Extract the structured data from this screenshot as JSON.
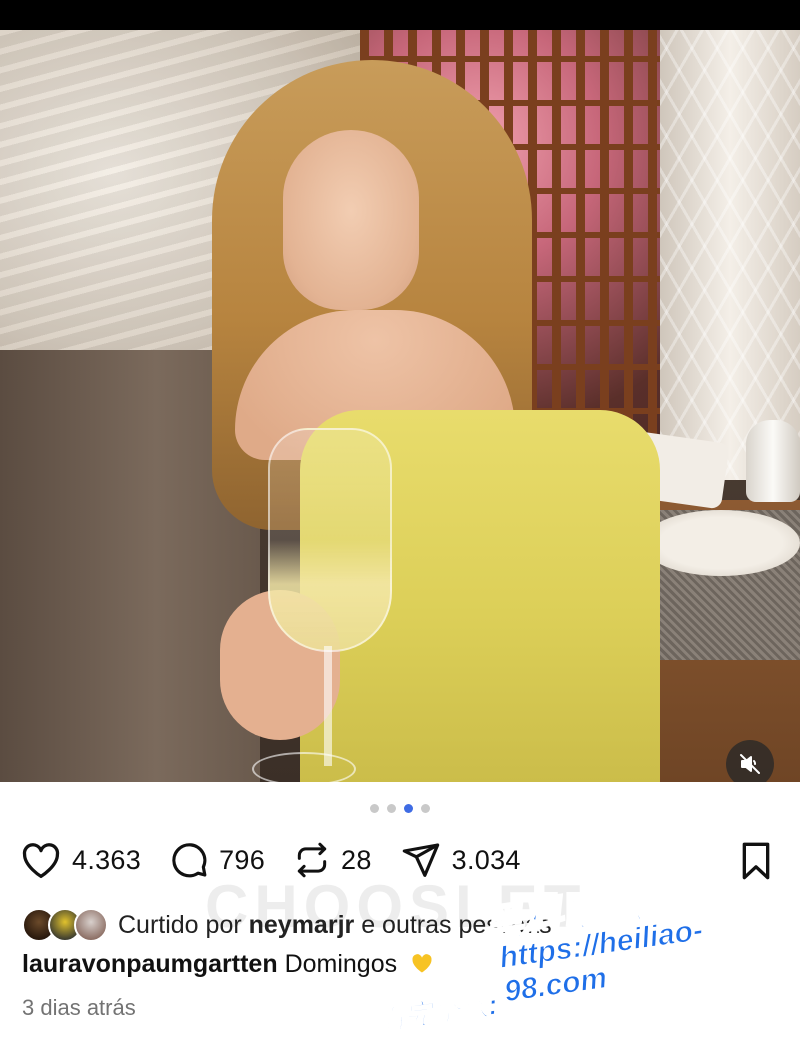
{
  "post": {
    "carousel": {
      "total": 4,
      "active_index": 2
    },
    "media": {
      "mute_icon": "speaker-muted-icon"
    },
    "actions": {
      "like": {
        "icon": "heart-icon",
        "count": "4.363"
      },
      "comment": {
        "icon": "comment-bubble-icon",
        "count": "796"
      },
      "repost": {
        "icon": "repost-icon",
        "count": "28"
      },
      "share": {
        "icon": "paper-plane-icon",
        "count": "3.034"
      },
      "save": {
        "icon": "bookmark-icon"
      }
    },
    "liked_by": {
      "prefix": "Curtido por ",
      "user": "neymarjr",
      "suffix": " e outras pessoas"
    },
    "caption": {
      "username": "lauravonpaumgartten",
      "text": "Domingos",
      "emoji": "yellow-heart-emoji"
    },
    "time_ago": "3 dias atrás"
  },
  "watermarks": {
    "faint_text": "CHOOSLET",
    "site_cn": "黑料吃瓜网",
    "site_prefix": "看完整版:",
    "site_url": "https://heiliao-98.com"
  },
  "colors": {
    "active_dot": "#3f6ce4",
    "watermark_blue": "#1f6fe8",
    "muted_text": "#737373"
  }
}
